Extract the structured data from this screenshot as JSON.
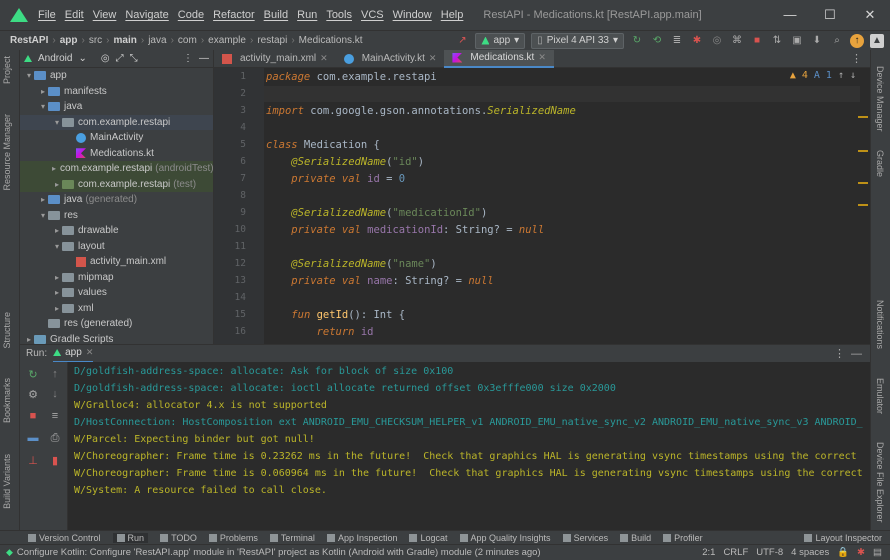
{
  "titlebar": {
    "menu": [
      "File",
      "Edit",
      "View",
      "Navigate",
      "Code",
      "Refactor",
      "Build",
      "Run",
      "Tools",
      "VCS",
      "Window",
      "Help"
    ],
    "window_title": "RestAPI - Medications.kt [RestAPI.app.main]",
    "controls": [
      "—",
      "☐",
      "✕"
    ]
  },
  "navbar": {
    "crumbs": [
      "RestAPI",
      "app",
      "src",
      "main",
      "java",
      "com",
      "example",
      "restapi",
      "Medications.kt"
    ],
    "run_config": "app",
    "device": "Pixel 4 API 33"
  },
  "project": {
    "view_mode": "Android",
    "tree": [
      {
        "label": "app",
        "indent": 0,
        "arrow": "▾",
        "icon": "folder-blue"
      },
      {
        "label": "manifests",
        "indent": 1,
        "arrow": "▸",
        "icon": "folder-blue"
      },
      {
        "label": "java",
        "indent": 1,
        "arrow": "▾",
        "icon": "folder-blue"
      },
      {
        "label": "com.example.restapi",
        "indent": 2,
        "arrow": "▾",
        "icon": "folder",
        "selected": true
      },
      {
        "label": "MainActivity",
        "indent": 3,
        "arrow": "",
        "icon": "activity"
      },
      {
        "label": "Medications.kt",
        "indent": 3,
        "arrow": "",
        "icon": "kotlin"
      },
      {
        "label": "com.example.restapi",
        "suffix": "(androidTest)",
        "indent": 2,
        "arrow": "▸",
        "icon": "folder-green",
        "highlight": true
      },
      {
        "label": "com.example.restapi",
        "suffix": "(test)",
        "indent": 2,
        "arrow": "▸",
        "icon": "folder-green",
        "highlight": true
      },
      {
        "label": "java",
        "suffix": "(generated)",
        "indent": 1,
        "arrow": "▸",
        "icon": "folder-blue"
      },
      {
        "label": "res",
        "indent": 1,
        "arrow": "▾",
        "icon": "folder"
      },
      {
        "label": "drawable",
        "indent": 2,
        "arrow": "▸",
        "icon": "folder"
      },
      {
        "label": "layout",
        "indent": 2,
        "arrow": "▾",
        "icon": "folder"
      },
      {
        "label": "activity_main.xml",
        "indent": 3,
        "arrow": "",
        "icon": "xml"
      },
      {
        "label": "mipmap",
        "indent": 2,
        "arrow": "▸",
        "icon": "folder"
      },
      {
        "label": "values",
        "indent": 2,
        "arrow": "▸",
        "icon": "folder"
      },
      {
        "label": "xml",
        "indent": 2,
        "arrow": "▸",
        "icon": "folder"
      },
      {
        "label": "res (generated)",
        "indent": 1,
        "arrow": "",
        "icon": "folder"
      },
      {
        "label": "Gradle Scripts",
        "indent": 0,
        "arrow": "▸",
        "icon": "gradle"
      }
    ]
  },
  "editor": {
    "tabs": [
      {
        "label": "activity_main.xml",
        "active": false
      },
      {
        "label": "MainActivity.kt",
        "active": false
      },
      {
        "label": "Medications.kt",
        "active": true
      }
    ],
    "inspection": {
      "warnings": "4",
      "typos": "1"
    },
    "lines": [
      {
        "n": "1",
        "html": "<span class='kw'>package</span> com.example.restapi"
      },
      {
        "n": "2",
        "html": ""
      },
      {
        "n": "3",
        "html": "<span class='kw'>import</span> com.google.gson.annotations.<span class='an'>SerializedName</span>"
      },
      {
        "n": "4",
        "html": ""
      },
      {
        "n": "5",
        "html": "<span class='kw'>class</span> Medication {"
      },
      {
        "n": "6",
        "html": "    <span class='an'>@SerializedName</span>(<span class='st'>\"id\"</span>)"
      },
      {
        "n": "7",
        "html": "    <span class='kw'>private val</span> <span class='fld'>id</span> = <span class='nm'>0</span>"
      },
      {
        "n": "8",
        "html": ""
      },
      {
        "n": "9",
        "html": "    <span class='an'>@SerializedName</span>(<span class='st'>\"medicationId\"</span>)"
      },
      {
        "n": "10",
        "html": "    <span class='kw'>private val</span> <span class='fld'>medicationId</span>: String? = <span class='kw'>null</span>"
      },
      {
        "n": "11",
        "html": ""
      },
      {
        "n": "12",
        "html": "    <span class='an'>@SerializedName</span>(<span class='st'>\"name\"</span>)"
      },
      {
        "n": "13",
        "html": "    <span class='kw'>private val</span> <span class='fld'>name</span>: String? = <span class='kw'>null</span>"
      },
      {
        "n": "14",
        "html": ""
      },
      {
        "n": "15",
        "html": "    <span class='kw'>fun</span> <span class='fn'>getId</span>(): Int {"
      },
      {
        "n": "16",
        "html": "        <span class='kw'>return</span> <span class='fld'>id</span>"
      }
    ]
  },
  "run": {
    "label": "Run:",
    "tab": "app",
    "log": [
      {
        "level": "d",
        "text": "D/goldfish-address-space: allocate: Ask for block of size 0x100"
      },
      {
        "level": "d",
        "text": "D/goldfish-address-space: allocate: ioctl allocate returned offset 0x3efffe000 size 0x2000"
      },
      {
        "level": "w",
        "text": "W/Gralloc4: allocator 4.x is not supported"
      },
      {
        "level": "d",
        "text": "D/HostConnection: HostComposition ext ANDROID_EMU_CHECKSUM_HELPER_v1 ANDROID_EMU_native_sync_v2 ANDROID_EMU_native_sync_v3 ANDROID_"
      },
      {
        "level": "w",
        "text": "W/Parcel: Expecting binder but got null!"
      },
      {
        "level": "w",
        "text": "W/Choreographer: Frame time is 0.23262 ms in the future!  Check that graphics HAL is generating vsync timestamps using the correct"
      },
      {
        "level": "w",
        "text": "W/Choreographer: Frame time is 0.060964 ms in the future!  Check that graphics HAL is generating vsync timestamps using the correct"
      },
      {
        "level": "w",
        "text": "W/System: A resource failed to call close."
      }
    ]
  },
  "left_stripe": [
    "Project",
    "Resource Manager",
    "Structure",
    "Bookmarks",
    "Build Variants"
  ],
  "right_stripe": [
    "Device Manager",
    "Gradle",
    "Notifications",
    "Emulator",
    "Device File Explorer"
  ],
  "bottom_tabs": [
    "Version Control",
    "Run",
    "TODO",
    "Problems",
    "Terminal",
    "App Inspection",
    "Logcat",
    "App Quality Insights",
    "Services",
    "Build",
    "Profiler",
    "Layout Inspector"
  ],
  "status": {
    "message": "Configure Kotlin: Configure 'RestAPI.app' module in 'RestAPI' project as Kotlin (Android with Gradle) module (2 minutes ago)",
    "position": "2:1",
    "line_sep": "CRLF",
    "encoding": "UTF-8",
    "indent": "4 spaces"
  }
}
